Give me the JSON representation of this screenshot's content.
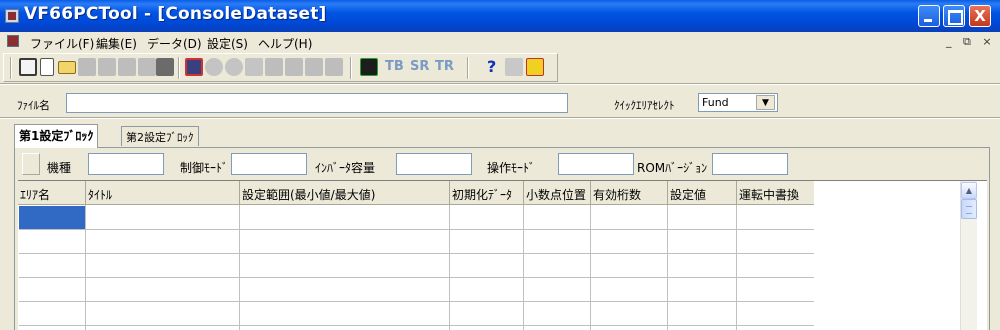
{
  "window": {
    "title": "VF66PCTool - [ConsoleDataset]",
    "minimize_icon": "minimize-icon",
    "maximize_icon": "maximize-icon",
    "close_glyph": "X"
  },
  "menu": {
    "items": [
      {
        "label": "ファイル(F)"
      },
      {
        "label": "編集(E)"
      },
      {
        "label": "データ(D)"
      },
      {
        "label": "設定(S)"
      },
      {
        "label": "ヘルプ(H)"
      }
    ],
    "mdi_controls": "_ ♬ ×"
  },
  "toolbar": {
    "text_buttons": [
      "TB",
      "SR",
      "TR"
    ],
    "help_glyph": "?"
  },
  "file_row": {
    "label": "ﾌｧｲﾙ名",
    "value": "",
    "quick_label": "ｸｲｯｸｴﾘｱｾﾚｸﾄ",
    "quick_value": "Fund",
    "dropdown_glyph": "▼"
  },
  "tabs": [
    {
      "label": "第1設定ﾌﾞﾛｯｸ",
      "active": true
    },
    {
      "label": "第2設定ﾌﾞﾛｯｸ",
      "active": false
    }
  ],
  "info": {
    "model_label": "機種",
    "model_value": "",
    "control_mode_label": "制御ﾓｰﾄﾞ",
    "control_mode_value": "",
    "inverter_capacity_label": "ｲﾝﾊﾞｰﾀ容量",
    "inverter_capacity_value": "",
    "operation_mode_label": "操作ﾓｰﾄﾞ",
    "operation_mode_value": "",
    "rom_version_label": "ROMﾊﾞｰｼﾞｮﾝ",
    "rom_version_value": ""
  },
  "grid": {
    "columns": [
      "ｴﾘｱ名",
      "ﾀｲﾄﾙ",
      "設定範囲(最小値/最大値)",
      "初期化ﾃﾞｰﾀ",
      "小数点位置",
      "有効桁数",
      "設定値",
      "運転中書換"
    ],
    "rows": [],
    "scroll_up_glyph": "▲"
  },
  "colors": {
    "title_bar": "#0054e3",
    "selection": "#316ac5",
    "background": "#ece9d8"
  }
}
